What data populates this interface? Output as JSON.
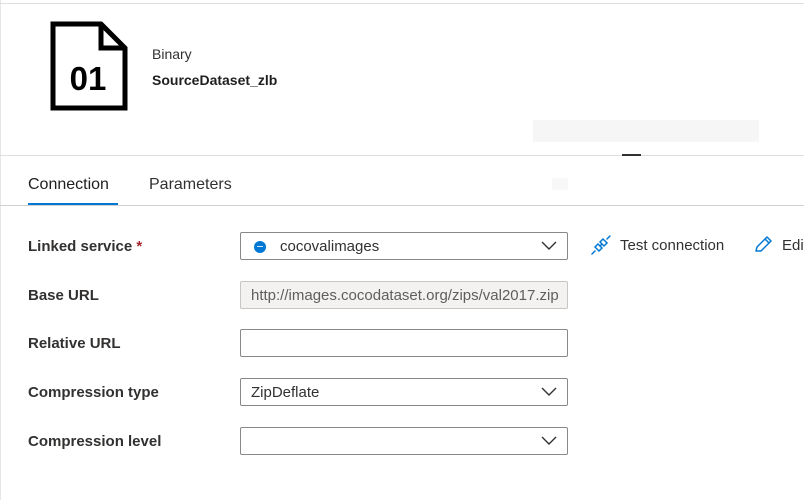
{
  "header": {
    "icon_text": "01",
    "dataset_type": "Binary",
    "dataset_name": "SourceDataset_zlb"
  },
  "tabs": [
    {
      "label": "Connection",
      "selected": true
    },
    {
      "label": "Parameters",
      "selected": false
    }
  ],
  "form": {
    "linked_service": {
      "label": "Linked service",
      "required_mark": "*",
      "value": "cocovalimages",
      "icon": "http-linked-service-icon"
    },
    "base_url": {
      "label": "Base URL",
      "value": "http://images.cocodataset.org/zips/val2017.zip"
    },
    "relative_url": {
      "label": "Relative URL",
      "value": ""
    },
    "compression_type": {
      "label": "Compression type",
      "value": "ZipDeflate"
    },
    "compression_level": {
      "label": "Compression level",
      "value": ""
    }
  },
  "actions": {
    "test_connection": "Test connection",
    "edit": "Edit"
  },
  "colors": {
    "accent": "#0078d4",
    "required": "#a4262c",
    "text": "#323130"
  }
}
